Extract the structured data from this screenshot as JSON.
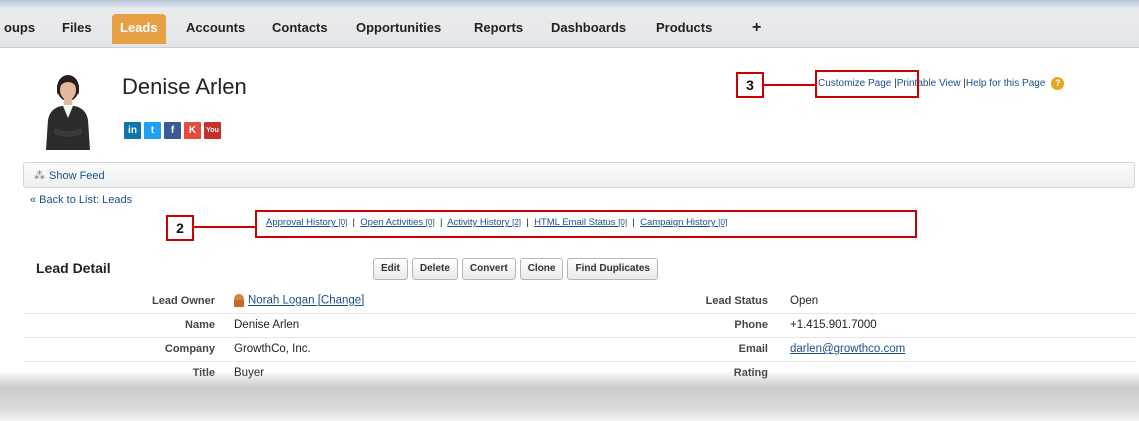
{
  "tabs": [
    {
      "label": "oups",
      "active": false
    },
    {
      "label": "Files",
      "active": false
    },
    {
      "label": "Leads",
      "active": true
    },
    {
      "label": "Accounts",
      "active": false
    },
    {
      "label": "Contacts",
      "active": false
    },
    {
      "label": "Opportunities",
      "active": false
    },
    {
      "label": "Reports",
      "active": false
    },
    {
      "label": "Dashboards",
      "active": false
    },
    {
      "label": "Products",
      "active": false
    },
    {
      "label": "+",
      "active": false
    }
  ],
  "header": {
    "name": "Denise Arlen",
    "social": [
      {
        "icon": "linkedin-icon",
        "text": "in",
        "color": "#0e76a8"
      },
      {
        "icon": "twitter-icon",
        "text": "t",
        "color": "#1da1f2"
      },
      {
        "icon": "facebook-icon",
        "text": "f",
        "color": "#3b5998"
      },
      {
        "icon": "klout-icon",
        "text": "K",
        "color": "#e74c3c"
      },
      {
        "icon": "youtube-icon",
        "text": "You",
        "color": "#c4302b"
      }
    ]
  },
  "top_links": {
    "customize": "Customize Page",
    "sep": "|",
    "printable": "Printable View",
    "help": "Help for this Page",
    "help_glyph": "?"
  },
  "callouts": {
    "related": "2",
    "customize": "3"
  },
  "feed": {
    "label": "Show Feed"
  },
  "back_link": "« Back to List: Leads",
  "related_links": [
    {
      "label": "Approval History",
      "count": "[0]"
    },
    {
      "label": "Open Activities",
      "count": "[0]"
    },
    {
      "label": "Activity History",
      "count": "[2]"
    },
    {
      "label": "HTML Email Status",
      "count": "[0]"
    },
    {
      "label": "Campaign History",
      "count": "[0]"
    }
  ],
  "related_sep": "|",
  "detail": {
    "title": "Lead Detail",
    "buttons": [
      "Edit",
      "Delete",
      "Convert",
      "Clone",
      "Find Duplicates"
    ],
    "rows": [
      {
        "label1": "Lead Owner",
        "value1": "Norah Logan [Change]",
        "label2": "Lead Status",
        "value2": "Open"
      },
      {
        "label1": "Name",
        "value1": "Denise Arlen",
        "label2": "Phone",
        "value2": "+1.415.901.7000"
      },
      {
        "label1": "Company",
        "value1": "GrowthCo, Inc.",
        "label2": "Email",
        "value2": "darlen@growthco.com"
      },
      {
        "label1": "Title",
        "value1": "Buyer",
        "label2": "Rating",
        "value2": ""
      }
    ]
  },
  "colors": {
    "active_tab": "#e8a045",
    "link": "#1a4f8c",
    "callout": "#cc0000"
  }
}
